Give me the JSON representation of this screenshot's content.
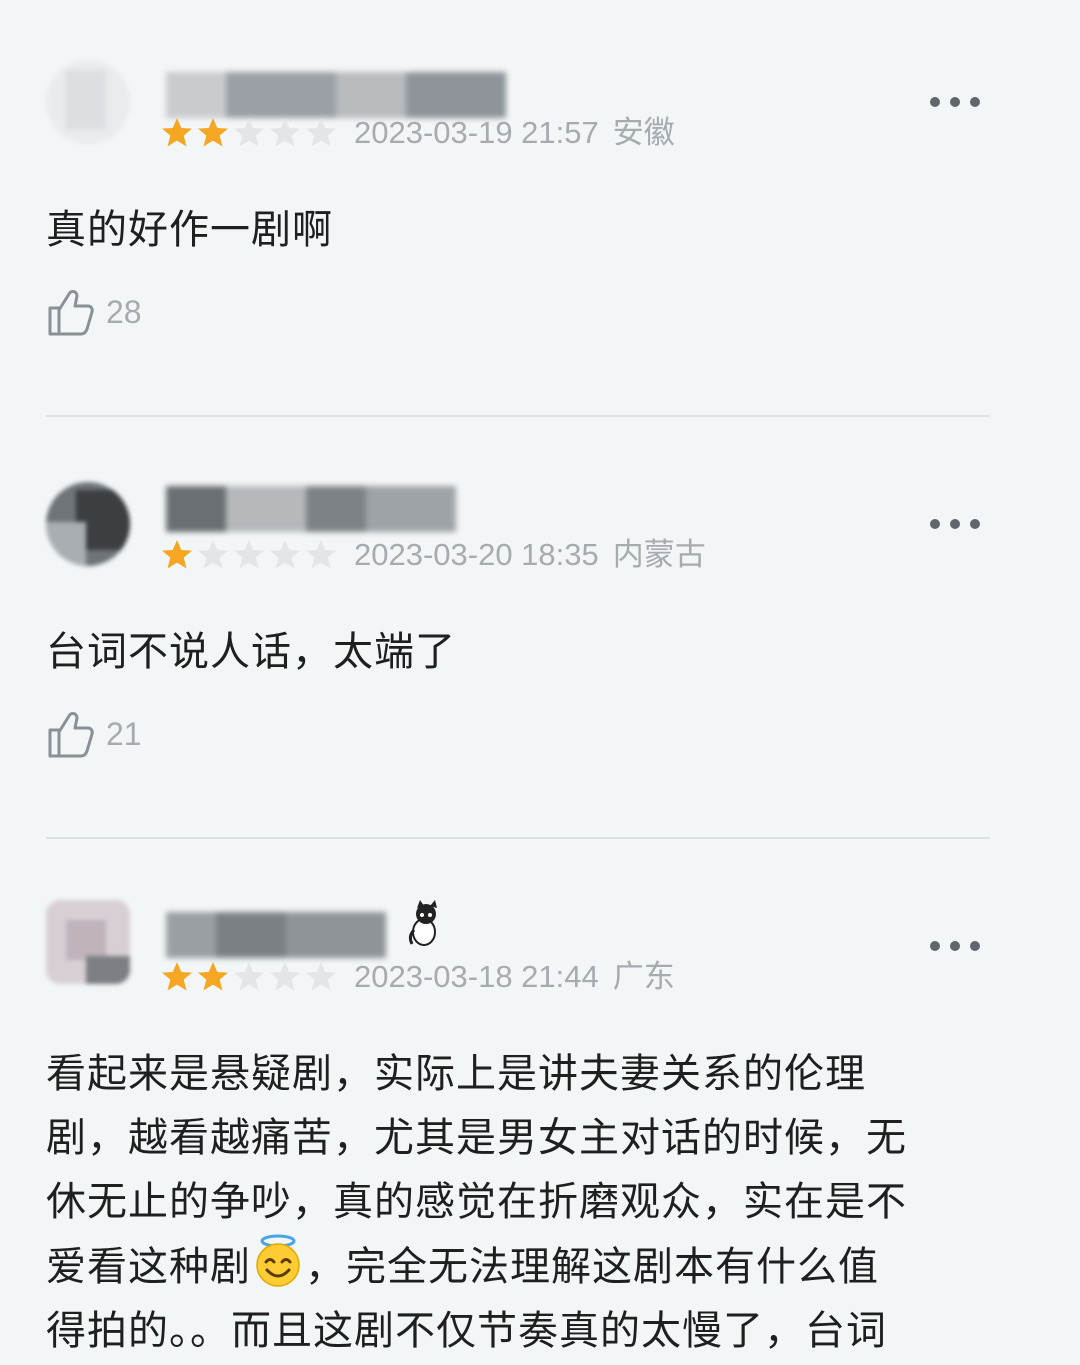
{
  "reviews": [
    {
      "rating": 2,
      "max_rating": 5,
      "date": "2023-03-19 21:57",
      "location": "安徽",
      "content": "真的好作一剧啊",
      "likes": "28",
      "more_icon": "more-dots-icon"
    },
    {
      "rating": 1,
      "max_rating": 5,
      "date": "2023-03-20 18:35",
      "location": "内蒙古",
      "content": "台词不说人话，太端了",
      "likes": "21",
      "more_icon": "more-dots-icon"
    },
    {
      "rating": 2,
      "max_rating": 5,
      "date": "2023-03-18 21:44",
      "location": "广东",
      "content_lines": [
        "看起来是悬疑剧，实际上是讲夫妻关系的伦理",
        "剧，越看越痛苦，尤其是男女主对话的时候，无",
        "休无止的争吵，真的感觉在折磨观众，实在是不",
        "爱看这种剧",
        "，完全无法理解这剧本有什么值",
        "得拍的。。而且这剧不仅节奏真的太慢了，台词"
      ],
      "content_emoji": "halo-smile-emoji",
      "more_icon": "more-dots-icon"
    }
  ],
  "colors": {
    "background": "#f2f6f7",
    "star_filled": "#f5a623",
    "star_empty": "#e3e6e8",
    "meta_text": "#a6abb0",
    "body_text": "#1f1f1f"
  }
}
